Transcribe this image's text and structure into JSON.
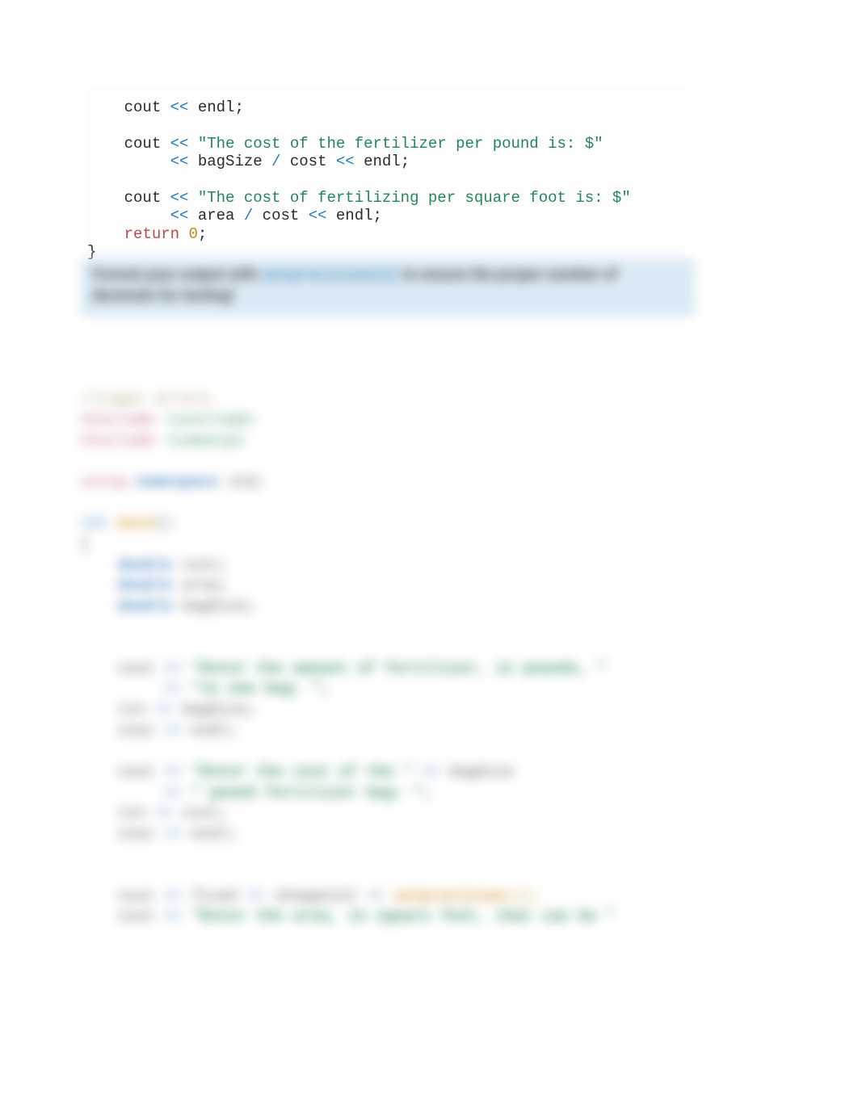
{
  "code": {
    "l1_a": "    cout ",
    "l1_op": "<<",
    "l1_b": " endl;",
    "l2": "",
    "l3_a": "    cout ",
    "l3_op1": "<<",
    "l3_sp": " ",
    "l3_str": "\"The cost of the fertilizer per pound is: $\"",
    "l4_pad": "         ",
    "l4_op1": "<<",
    "l4_b": " bagSize ",
    "l4_div": "/",
    "l4_c": " cost ",
    "l4_op2": "<<",
    "l4_d": " endl;",
    "l5": "",
    "l6_a": "    cout ",
    "l6_op1": "<<",
    "l6_sp": " ",
    "l6_str": "\"The cost of fertilizing per square foot is: $\"",
    "l7_pad": "         ",
    "l7_op1": "<<",
    "l7_b": " area ",
    "l7_div": "/",
    "l7_c": " cost ",
    "l7_op2": "<<",
    "l7_d": " endl;",
    "l8_a": "    ",
    "l8_kw": "return",
    "l8_sp": " ",
    "l8_num": "0",
    "l8_semi": ";",
    "l9": "}"
  },
  "hint": {
    "before": "Format your output with ",
    "mono": "setprecision(2)",
    "after": " to ensure the proper number of decimals for testing!"
  },
  "blurred": {
    "l1": "//Logic errors.",
    "inc": "#include",
    "inc_ios": " <iostream>",
    "inc_iom": " <iomanip>",
    "blank": "",
    "using": "using",
    "ns": " namespace ",
    "std": "std;",
    "int": "int ",
    "main": "main",
    "parens": "()",
    "brace_open": "{",
    "dbl": "    double",
    "v_cost": " cost;",
    "v_area": " area;",
    "v_bag": " bagSize;",
    "c_pre": "    cout ",
    "op": "<<",
    "sp": " ",
    "s_enter_amount": "\"Enter the amount of fertilizer, in pounds, \"",
    "pad": "         ",
    "s_in_one_bag": "\"in one bag: \"",
    "semicolon": ";",
    "cin_pre": "    cin ",
    "op_in": ">>",
    "bagsize": " bagSize;",
    "endl": " endl;",
    "s_enter_cost": "\"Enter the cost of the \"",
    "space_op_space": " << ",
    "bagsize_var": "bagSize",
    "s_pound_bag": "\" pound fertilizer bag: \"",
    "cost_var": " cost;",
    "fixed": " fixed ",
    "showpoint": " showpoint ",
    "setprecision": "setprecision",
    "two": "(2);",
    "s_enter_area": "\"Enter the area, in square feet, that can be \""
  }
}
